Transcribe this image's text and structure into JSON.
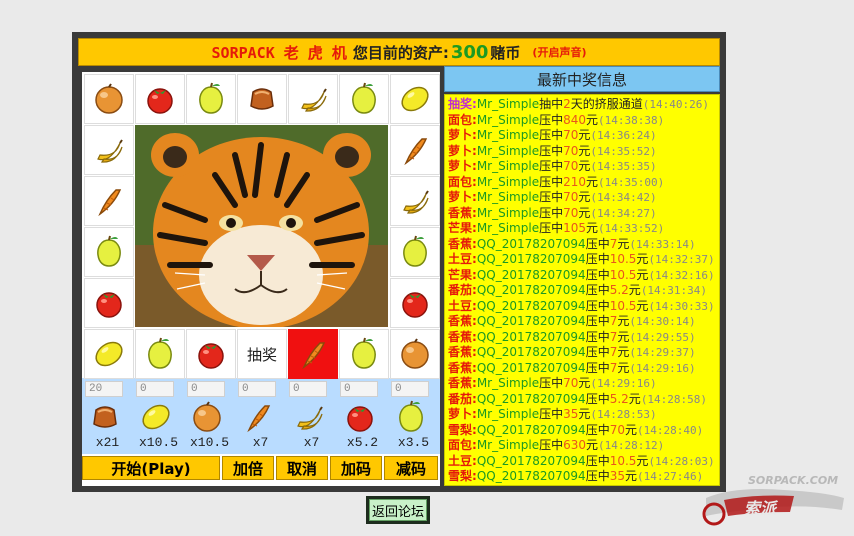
{
  "header": {
    "brand": "SORPACK 老 虎 机",
    "assets_label": "您目前的资产:",
    "assets": "300",
    "unit": "赌币",
    "sound": "(开启声音)"
  },
  "board": {
    "draw_label": "抽奖"
  },
  "bets": [
    {
      "value": "20",
      "odds": "x21",
      "icon": "bread-icon"
    },
    {
      "value": "0",
      "odds": "x10.5",
      "icon": "lemon-icon"
    },
    {
      "value": "0",
      "odds": "x10.5",
      "icon": "orange-icon"
    },
    {
      "value": "0",
      "odds": "x7",
      "icon": "carrot-icon"
    },
    {
      "value": "0",
      "odds": "x7",
      "icon": "banana-icon"
    },
    {
      "value": "0",
      "odds": "x5.2",
      "icon": "tomato-icon"
    },
    {
      "value": "0",
      "odds": "x3.5",
      "icon": "pear-icon"
    }
  ],
  "buttons": {
    "start": "开始(Play)",
    "double": "加倍",
    "cancel": "取消",
    "add": "加码",
    "reduce": "减码"
  },
  "winners": {
    "title": "最新中奖信息",
    "rows": [
      {
        "type": "抽奖:",
        "user": "Mr_Simple",
        "action": "抽中",
        "amount": "2",
        "unit": "天的挤服通道",
        "time": "(14:40:26)"
      },
      {
        "type": "面包:",
        "user": "Mr_Simple",
        "action": "压中",
        "amount": "840",
        "unit": "元",
        "time": "(14:38:38)"
      },
      {
        "type": "萝卜:",
        "user": "Mr_Simple",
        "action": "压中",
        "amount": "70",
        "unit": "元",
        "time": "(14:36:24)"
      },
      {
        "type": "萝卜:",
        "user": "Mr_Simple",
        "action": "压中",
        "amount": "70",
        "unit": "元",
        "time": "(14:35:52)"
      },
      {
        "type": "萝卜:",
        "user": "Mr_Simple",
        "action": "压中",
        "amount": "70",
        "unit": "元",
        "time": "(14:35:35)"
      },
      {
        "type": "面包:",
        "user": "Mr_Simple",
        "action": "压中",
        "amount": "210",
        "unit": "元",
        "time": "(14:35:00)"
      },
      {
        "type": "萝卜:",
        "user": "Mr_Simple",
        "action": "压中",
        "amount": "70",
        "unit": "元",
        "time": "(14:34:42)"
      },
      {
        "type": "香蕉:",
        "user": "Mr_Simple",
        "action": "压中",
        "amount": "70",
        "unit": "元",
        "time": "(14:34:27)"
      },
      {
        "type": "芒果:",
        "user": "Mr_Simple",
        "action": "压中",
        "amount": "105",
        "unit": "元",
        "time": "(14:33:52)"
      },
      {
        "type": "香蕉:",
        "user": "QQ_20178207094",
        "action": "压中",
        "amount": "7",
        "unit": "元",
        "time": "(14:33:14)"
      },
      {
        "type": "土豆:",
        "user": "QQ_20178207094",
        "action": "压中",
        "amount": "10.5",
        "unit": "元",
        "time": "(14:32:37)"
      },
      {
        "type": "芒果:",
        "user": "QQ_20178207094",
        "action": "压中",
        "amount": "10.5",
        "unit": "元",
        "time": "(14:32:16)"
      },
      {
        "type": "番茄:",
        "user": "QQ_20178207094",
        "action": "压中",
        "amount": "5.2",
        "unit": "元",
        "time": "(14:31:34)"
      },
      {
        "type": "土豆:",
        "user": "QQ_20178207094",
        "action": "压中",
        "amount": "10.5",
        "unit": "元",
        "time": "(14:30:33)"
      },
      {
        "type": "香蕉:",
        "user": "QQ_20178207094",
        "action": "压中",
        "amount": "7",
        "unit": "元",
        "time": "(14:30:14)"
      },
      {
        "type": "香蕉:",
        "user": "QQ_20178207094",
        "action": "压中",
        "amount": "7",
        "unit": "元",
        "time": "(14:29:55)"
      },
      {
        "type": "香蕉:",
        "user": "QQ_20178207094",
        "action": "压中",
        "amount": "7",
        "unit": "元",
        "time": "(14:29:37)"
      },
      {
        "type": "香蕉:",
        "user": "QQ_20178207094",
        "action": "压中",
        "amount": "7",
        "unit": "元",
        "time": "(14:29:16)"
      },
      {
        "type": "香蕉:",
        "user": "Mr_Simple",
        "action": "压中",
        "amount": "70",
        "unit": "元",
        "time": "(14:29:16)"
      },
      {
        "type": "番茄:",
        "user": "QQ_20178207094",
        "action": "压中",
        "amount": "5.2",
        "unit": "元",
        "time": "(14:28:58)"
      },
      {
        "type": "萝卜:",
        "user": "Mr_Simple",
        "action": "压中",
        "amount": "35",
        "unit": "元",
        "time": "(14:28:53)"
      },
      {
        "type": "雪梨:",
        "user": "QQ_20178207094",
        "action": "压中",
        "amount": "70",
        "unit": "元",
        "time": "(14:28:40)"
      },
      {
        "type": "面包:",
        "user": "Mr_Simple",
        "action": "压中",
        "amount": "630",
        "unit": "元",
        "time": "(14:28:12)"
      },
      {
        "type": "土豆:",
        "user": "QQ_20178207094",
        "action": "压中",
        "amount": "10.5",
        "unit": "元",
        "time": "(14:28:03)"
      },
      {
        "type": "雪梨:",
        "user": "QQ_20178207094",
        "action": "压中",
        "amount": "35",
        "unit": "元",
        "time": "(14:27:46)"
      }
    ]
  },
  "footer": {
    "back": "返回论坛",
    "watermark": "SORPACK.COM"
  }
}
